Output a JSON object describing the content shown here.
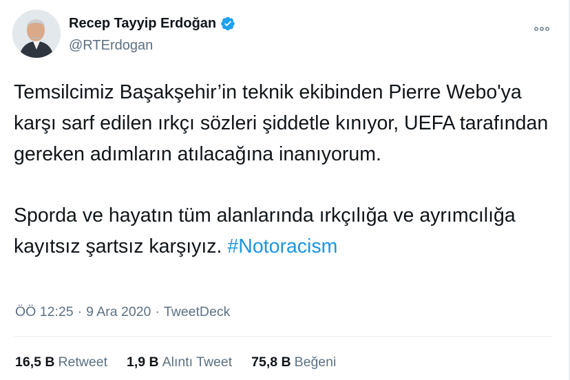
{
  "author": {
    "name": "Recep Tayyip Erdoğan",
    "handle": "@RTErdogan",
    "verified": true,
    "avatar_icon": "avatar-photo"
  },
  "tweet": {
    "paragraph1": "Temsilcimiz Başakşehir’in teknik ekibinden Pierre Webo'ya karşı sarf edilen ırkçı sözleri şiddetle kınıyor, UEFA tarafından gereken adımların atılacağına inanıyorum.",
    "paragraph2": "Sporda ve hayatın tüm alanlarında ırkçılığa ve ayrımcılığa kayıtsız şartsız karşıyız.",
    "hashtag": "#Notoracism"
  },
  "meta": {
    "time": "ÖÖ 12:25",
    "separator": "·",
    "date": "9 Ara 2020",
    "source": "TweetDeck"
  },
  "stats": {
    "retweets_count": "16,5 B",
    "retweets_label": "Retweet",
    "quotes_count": "1,9 B",
    "quotes_label": "Alıntı Tweet",
    "likes_count": "75,8 B",
    "likes_label": "Beğeni"
  },
  "colors": {
    "text": "#0f1419",
    "secondary": "#5b7083",
    "link": "#1b95e0",
    "verified_badge": "#1da1f2",
    "divider": "#e6ecf0"
  }
}
